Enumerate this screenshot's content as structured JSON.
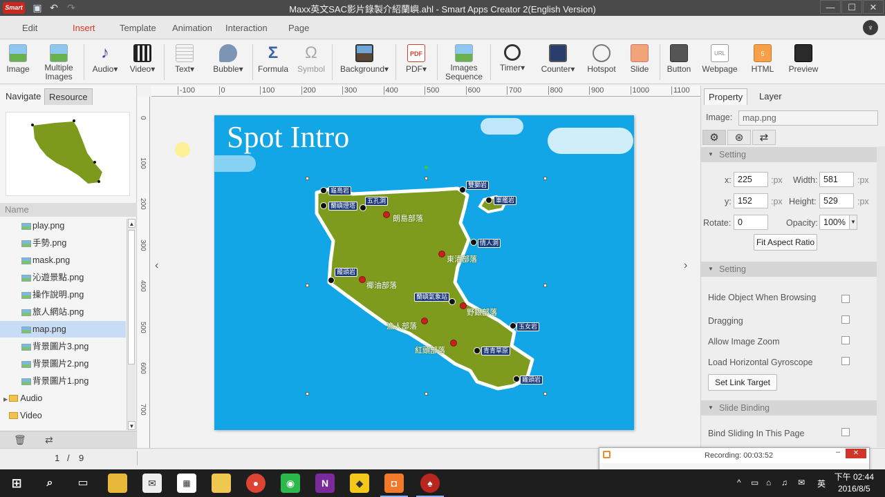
{
  "window": {
    "title": "Maxx英文SAC影片錄製介紹蘭嶼.ahl - Smart Apps Creator 2(English Version)",
    "logo_text": "Smart"
  },
  "menu": {
    "tabs": [
      {
        "label": "Edit"
      },
      {
        "label": "Insert"
      },
      {
        "label": "Template"
      },
      {
        "label": "Animation"
      },
      {
        "label": "Interaction"
      },
      {
        "label": "Page"
      }
    ],
    "active_tab": "Insert"
  },
  "toolbar": {
    "items": [
      {
        "label": "Image",
        "icon": "image-icon"
      },
      {
        "label": "Multiple",
        "label2": "Images",
        "icon": "multiple-images-icon"
      },
      {
        "label": "Audio▾",
        "icon": "audio-icon"
      },
      {
        "label": "Video▾",
        "icon": "video-icon"
      },
      {
        "label": "Text▾",
        "icon": "text-icon"
      },
      {
        "label": "Bubble▾",
        "icon": "bubble-icon"
      },
      {
        "label": "Formula",
        "icon": "formula-icon"
      },
      {
        "label": "Symbol",
        "icon": "symbol-icon"
      },
      {
        "label": "Background▾",
        "icon": "background-icon"
      },
      {
        "label": "PDF▾",
        "icon": "pdf-icon"
      },
      {
        "label": "Images",
        "label2": "Sequence",
        "icon": "images-sequence-icon"
      },
      {
        "label": "Timer▾",
        "icon": "timer-icon"
      },
      {
        "label": "Counter▾",
        "icon": "counter-icon"
      },
      {
        "label": "Hotspot",
        "icon": "hotspot-icon"
      },
      {
        "label": "Slide",
        "icon": "slide-icon"
      },
      {
        "label": "Button",
        "icon": "button-icon"
      },
      {
        "label": "Webpage",
        "icon": "webpage-icon"
      },
      {
        "label": "HTML",
        "icon": "html-icon"
      },
      {
        "label": "Preview",
        "icon": "preview-icon"
      }
    ]
  },
  "left_panel": {
    "tabs": [
      "Navigate",
      "Resource"
    ],
    "active_tab": "Resource",
    "name_header": "Name",
    "files": [
      {
        "name": "play.png"
      },
      {
        "name": "手勢.png"
      },
      {
        "name": "mask.png"
      },
      {
        "name": "沁遊景點.png"
      },
      {
        "name": "操作說明.png"
      },
      {
        "name": "旅人網站.png"
      },
      {
        "name": "map.png",
        "selected": true
      },
      {
        "name": "背景圖片3.png"
      },
      {
        "name": "背景圖片2.png"
      },
      {
        "name": "背景圖片1.png"
      }
    ],
    "folders": [
      {
        "name": "Audio"
      },
      {
        "name": "Video"
      }
    ]
  },
  "canvas": {
    "slide_title": "Spot Intro",
    "hruler_labels": [
      "-100",
      "0",
      "100",
      "200",
      "300",
      "400",
      "500",
      "600",
      "700",
      "800",
      "900",
      "1000",
      "1100"
    ],
    "vruler_labels": [
      "0",
      "100",
      "200",
      "300",
      "400",
      "500",
      "600",
      "700"
    ],
    "map_labels": [
      "龜島岩",
      "蘭嶼燈塔",
      "五孔洞",
      "雙獅岩",
      "軍艦岩",
      "情人洞",
      "饅頭岩",
      "蘭嶼氣象站",
      "玉女岩",
      "青青草原",
      "雞頭岩"
    ],
    "village_labels": [
      "朗島部落",
      "東清部落",
      "椰油部落",
      "野銀部落",
      "漁人部落",
      "紅頭部落"
    ]
  },
  "right_panel": {
    "tabs": [
      "Property",
      "Layer"
    ],
    "active_tab": "Property",
    "image_label": "Image:",
    "image_value": "map.png",
    "section1": "Setting",
    "x_label": "x:",
    "x_value": "225",
    "y_label": "y:",
    "y_value": "152",
    "unit": ":px",
    "width_label": "Width:",
    "width_value": "581",
    "height_label": "Height:",
    "height_value": "529",
    "rotate_label": "Rotate:",
    "rotate_value": "0",
    "opacity_label": "Opacity:",
    "opacity_value": "100%",
    "fit_button": "Fit Aspect Ratio",
    "section2": "Setting",
    "options": [
      {
        "label": "Hide Object When Browsing",
        "checked": false
      },
      {
        "label": "Dragging",
        "checked": false
      },
      {
        "label": "Allow Image Zoom",
        "checked": false
      },
      {
        "label": "Load Horizontal Gyroscope",
        "checked": false
      }
    ],
    "link_button": "Set Link Target",
    "section3": "Slide Binding",
    "bind_label": "Bind Sliding In This Page"
  },
  "status": {
    "page_current": "1",
    "page_sep": "/",
    "page_total": "9"
  },
  "recording": {
    "text": "Recording: 00:03:52"
  },
  "taskbar": {
    "time": "下午 02:44",
    "date": "2016/8/5",
    "ime": "英"
  }
}
